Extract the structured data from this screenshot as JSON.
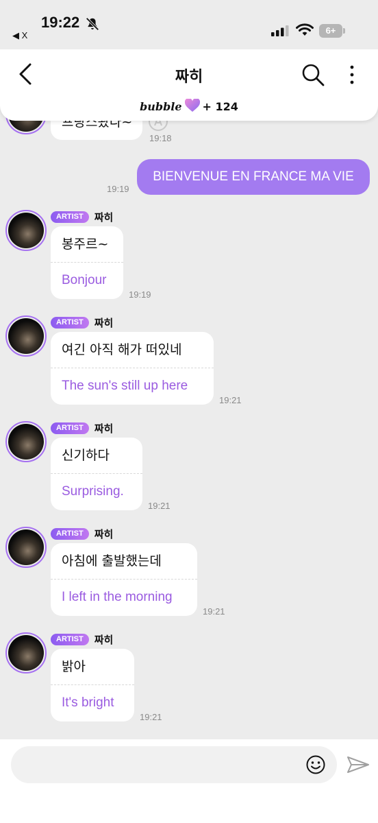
{
  "status_bar": {
    "time": "19:22",
    "back_app": "◀ X",
    "battery": "6+"
  },
  "header": {
    "title": "짜히",
    "bubble_logo": "bubble",
    "bubble_count": "+ 124"
  },
  "colors": {
    "accent": "#a37bf0",
    "translation": "#9a5be0",
    "badge_start": "#8c5cf0",
    "badge_end": "#c078f0",
    "background": "#ececec"
  },
  "messages": {
    "top_partial": {
      "ko": "프랑스왔다~",
      "time": "19:18"
    },
    "outgoing": {
      "text": "BIENVENUE EN FRANCE MA VIE",
      "time": "19:19"
    },
    "m1": {
      "badge": "ARTIST",
      "name": "짜히",
      "ko": "봉주르~",
      "en": "Bonjour",
      "time": "19:19"
    },
    "m2": {
      "badge": "ARTIST",
      "name": "짜히",
      "ko": "여긴 아직 해가 떠있네",
      "en": "The sun's still up here",
      "time": "19:21"
    },
    "m3": {
      "badge": "ARTIST",
      "name": "짜히",
      "ko": "신기하다",
      "en": "Surprising.",
      "time": "19:21"
    },
    "m4": {
      "badge": "ARTIST",
      "name": "짜히",
      "ko": "아침에 출발했는데",
      "en": "I left in the morning",
      "time": "19:21"
    },
    "m5": {
      "badge": "ARTIST",
      "name": "짜히",
      "ko": "밝아",
      "en": "It's bright",
      "time": "19:21"
    }
  },
  "composer": {
    "placeholder": "",
    "icons": [
      "emoji-icon",
      "send-icon"
    ]
  }
}
